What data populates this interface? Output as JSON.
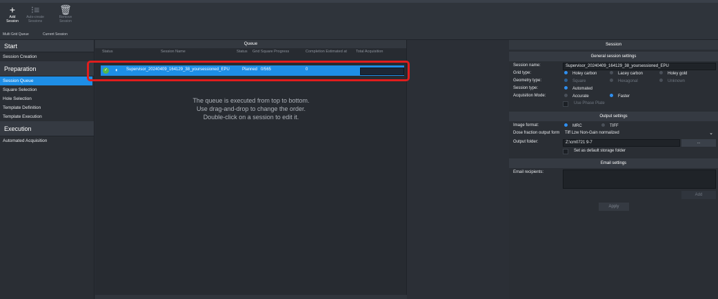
{
  "toolbar": {
    "buttons": [
      {
        "glyph": "+",
        "label1": "Add",
        "label2": "Session",
        "icon": "plus-icon"
      },
      {
        "glyph": "⁝≡",
        "label1": "Auto-create",
        "label2": "Sessions",
        "icon": "auto-create-icon"
      },
      {
        "glyph": "🗑",
        "label1": "Remove",
        "label2": "Session",
        "icon": "trash-icon"
      }
    ],
    "groups": [
      "Multi Grid Queue",
      "Current Session"
    ]
  },
  "sidebar": {
    "sections": [
      {
        "title": "Start",
        "items": [
          "Session Creation"
        ]
      },
      {
        "title": "Preparation",
        "items": [
          "Session Queue",
          "Square Selection",
          "Hole Selection",
          "Template Definition",
          "Template Execution"
        ]
      },
      {
        "title": "Execution",
        "items": [
          "Automated Acquisition"
        ]
      }
    ],
    "active_item": "Session Queue"
  },
  "queue": {
    "title": "Queue",
    "columns": [
      "Status",
      "Session Name",
      "Status",
      "Grid Square Progress",
      "Completion Estimated at",
      "Total Acquisition"
    ],
    "rows": [
      {
        "name": "Supervisor_20240409_164129_38_yoursessioned_EPU",
        "status": "Planned",
        "progress": "0/565",
        "count": "0"
      }
    ],
    "hint": [
      "The queue is executed from top to bottom.",
      "Use drag-and-drop to change the order.",
      "Double-click on a session to edit it."
    ]
  },
  "session": {
    "title": "Session",
    "general": {
      "title": "General session settings",
      "name_label": "Session name:",
      "name_value": "Supervisor_20240409_164129_38_yoursessioned_EPU",
      "grid_label": "Grid type:",
      "grid_options": [
        "Holey carbon",
        "Lacey carbon",
        "Holey gold"
      ],
      "geometry_label": "Geometry type:",
      "geometry_options": [
        "Square",
        "Hexagonal",
        "Unknown"
      ],
      "type_label": "Session type:",
      "type_value": "Automated",
      "mode_label": "Acquisition Mode:",
      "mode_options": [
        "Accurate",
        "Faster"
      ],
      "phase_plate": "Use Phase Plate"
    },
    "output": {
      "title": "Output settings",
      "format_label": "Image format:",
      "format_options": [
        "MRC",
        "TIFF"
      ],
      "dose_label": "Dose fraction output form",
      "dose_value": "Tiff Lzw Non-Gain normalized",
      "folder_label": "Output folder:",
      "folder_value": "Z:\\cm0721 9-7",
      "browse": "...",
      "default_storage": "Set as default storage folder"
    },
    "email": {
      "title": "Email settings",
      "recipients_label": "Email recipients:",
      "add": "Add"
    },
    "apply": "Apply"
  }
}
